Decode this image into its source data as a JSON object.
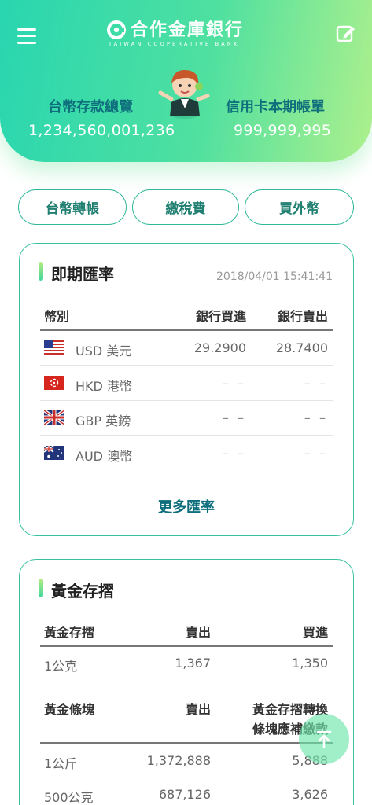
{
  "header": {
    "bank_name_cn": "合作金庫銀行",
    "bank_name_en": "TAIWAN COOPERATIVE BANK",
    "deposit_label": "台幣存款總覽",
    "deposit_value": "1,234,560,001,236",
    "credit_label": "信用卡本期帳單",
    "credit_value": "999,999,995",
    "menu_icon": "hamburger-menu-icon",
    "edit_icon": "edit-icon"
  },
  "quick_actions": [
    {
      "label": "台幣轉帳"
    },
    {
      "label": "繳稅費"
    },
    {
      "label": "買外幣"
    }
  ],
  "fx": {
    "title": "即期匯率",
    "timestamp": "2018/04/01 15:41:41",
    "col_currency": "幣別",
    "col_buy": "銀行買進",
    "col_sell": "銀行賣出",
    "rows": [
      {
        "currency": "USD 美元",
        "buy": "29.2900",
        "sell": "28.7400",
        "flag": "us-flag-icon"
      },
      {
        "currency": "HKD 港幣",
        "buy": "– –",
        "sell": "– –",
        "flag": "hk-flag-icon"
      },
      {
        "currency": "GBP 英鎊",
        "buy": "– –",
        "sell": "– –",
        "flag": "uk-flag-icon"
      },
      {
        "currency": "AUD 澳幣",
        "buy": "– –",
        "sell": "– –",
        "flag": "au-flag-icon"
      }
    ],
    "more_label": "更多匯率"
  },
  "gold": {
    "title": "黃金存摺",
    "passbook": {
      "col_name": "黃金存摺",
      "col_sell": "賣出",
      "col_buy": "買進",
      "rows": [
        {
          "name": "1公克",
          "sell": "1,367",
          "buy": "1,350"
        }
      ]
    },
    "bars": {
      "col_name": "黃金條塊",
      "col_sell": "賣出",
      "col_extra_line1": "黃金存摺轉換",
      "col_extra_line2": "條塊應補繳款",
      "rows": [
        {
          "name": "1公斤",
          "sell": "1,372,888",
          "extra": "5,888"
        },
        {
          "name": "500公克",
          "sell": "687,126",
          "extra": "3,626"
        }
      ]
    }
  },
  "fab_icon": "scroll-to-top-icon",
  "colors": {
    "brand_gradient_start": "#29d6b0",
    "brand_gradient_end": "#aef08c",
    "accent_teal": "#0e6e7c",
    "border_green": "#38c0a0"
  }
}
